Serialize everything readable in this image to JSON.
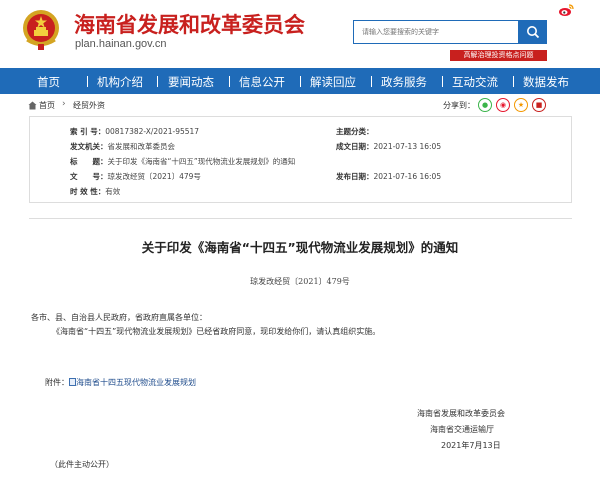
{
  "header": {
    "site_title": "海南省发展和改革委员会",
    "site_url": "plan.hainan.gov.cn",
    "search_placeholder": "请输入您要搜索的关键字",
    "hot_tag": "高解治理投资格点问题",
    "brand_red": "#c8201e",
    "brand_blue": "#1f6bb8"
  },
  "nav": {
    "items": [
      "首页",
      "机构介绍",
      "要闻动态",
      "信息公开",
      "解读回应",
      "政务服务",
      "互动交流",
      "数据发布"
    ]
  },
  "breadcrumb": {
    "home": "首页",
    "separator": "›",
    "current": "经贸外资",
    "share_label": "分享到："
  },
  "info": {
    "index_key": "索 引 号：",
    "index_val": "00817382-X/2021-95517",
    "topic_key": "主题分类：",
    "topic_val": "",
    "issuer_key": "发文机关：",
    "issuer_val": "省发展和改革委员会",
    "date_key": "成文日期：",
    "date_val": "2021-07-13 16:05",
    "title_key": "标　　题：",
    "title_val": "关于印发《海南省“十四五”现代物流业发展规划》的通知",
    "docno_key": "文　　号：",
    "docno_val": "琼发改经贸〔2021〕479号",
    "pub_key": "发布日期：",
    "pub_val": "2021-07-16 16:05",
    "valid_key": "时 效 性：",
    "valid_val": "有效"
  },
  "document": {
    "title": "关于印发《海南省“十四五”现代物流业发展规划》的通知",
    "doc_no": "琼发改经贸〔2021〕479号",
    "recipients": "各市、县、自治县人民政府，省政府直属各单位：",
    "body": "《海南省“十四五”现代物流业发展规划》已经省政府同意，现印发给你们，请认真组织实施。",
    "attach_label": "附件：",
    "attach_link": "海南省十四五现代物流业发展规划",
    "sign_org1": "海南省发展和改革委员会",
    "sign_org2": "海南省交通运输厅",
    "sign_date": "2021年7月13日",
    "note": "（此件主动公开）"
  }
}
